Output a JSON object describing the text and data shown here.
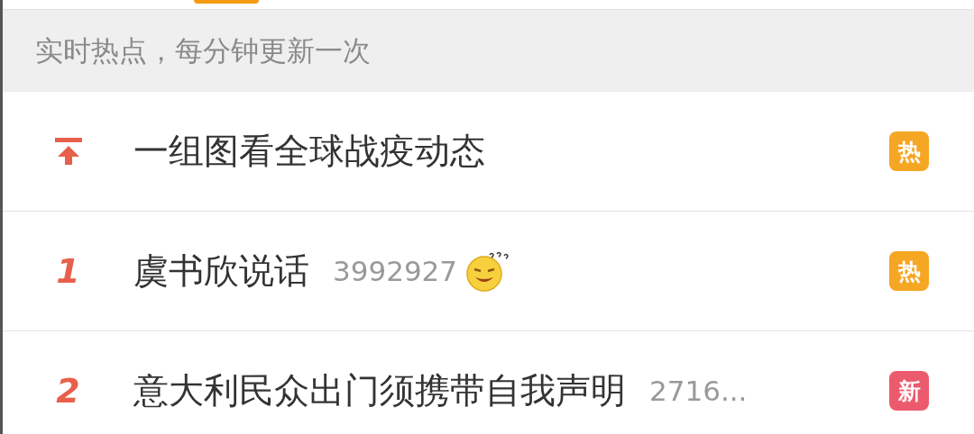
{
  "header": {
    "text": "实时热点，每分钟更新一次"
  },
  "rows": [
    {
      "kind": "pinned",
      "title": "一组图看全球战疫动态",
      "badge": "热",
      "color": "#f5a623",
      "emoji": false
    },
    {
      "kind": "ranked",
      "rank": "1",
      "title": "虞书欣说话",
      "count": "3992927",
      "badge": "热",
      "color": "#f5a623",
      "emoji": true
    },
    {
      "kind": "ranked",
      "rank": "2",
      "title": "意大利民众出门须携带自我声明",
      "count": "2716...",
      "badge": "新",
      "color": "#ec5a6e",
      "emoji": false
    }
  ]
}
